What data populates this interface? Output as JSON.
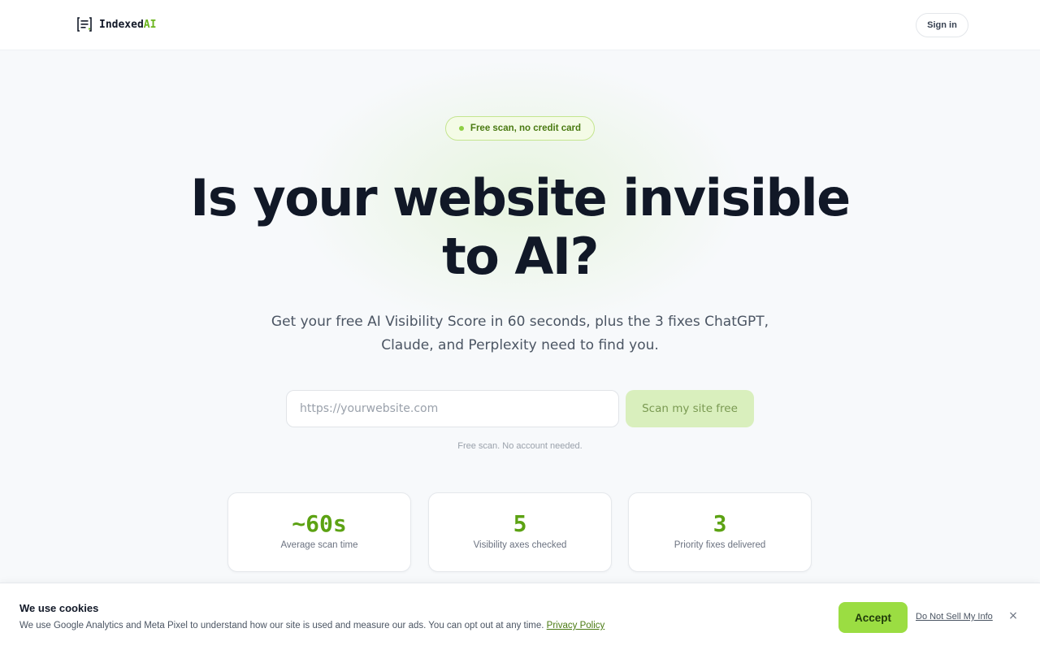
{
  "header": {
    "logo_text": "Indexed",
    "logo_accent": "AI",
    "signin_label": "Sign in"
  },
  "hero": {
    "badge": "Free scan, no credit card",
    "title_line1": "Is your website invisible",
    "title_line2": "to AI?",
    "subtitle_line1": "Get your free AI Visibility Score in 60 seconds, plus the 3 fixes ChatGPT,",
    "subtitle_line2": "Claude, and Perplexity need to find you."
  },
  "scan": {
    "placeholder": "https://yourwebsite.com",
    "value": "",
    "button_label": "Scan my site free",
    "note": "Free scan. No account needed."
  },
  "stats": [
    {
      "value": "~60s",
      "label": "Average scan time"
    },
    {
      "value": "5",
      "label": "Visibility axes checked"
    },
    {
      "value": "3",
      "label": "Priority fixes delivered"
    }
  ],
  "cookie": {
    "title": "We use cookies",
    "text": "We use Google Analytics and Meta Pixel to understand how our site is used and measure our ads. You can opt out at any time.",
    "policy_link": "Privacy Policy",
    "accept_label": "Accept",
    "do_not_sell_label": "Do Not Sell My Info",
    "close_label": "×"
  },
  "colors": {
    "accent": "#6bb51d",
    "accept_bg": "#9bdd42",
    "scan_button_bg": "#d9efbd",
    "badge_border": "#c4e58f"
  },
  "icons": {
    "logo": "document-brackets-icon",
    "badge_dot": "status-dot-icon",
    "close": "close-icon"
  }
}
